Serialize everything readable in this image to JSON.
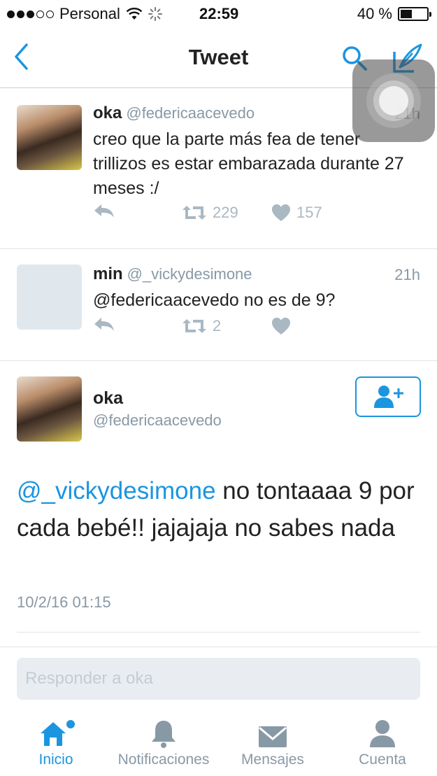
{
  "status_bar": {
    "carrier": "Personal",
    "time": "22:59",
    "battery": "40 %"
  },
  "nav": {
    "title": "Tweet"
  },
  "tweets": [
    {
      "name": "oka",
      "handle": "@federicaacevedo",
      "time": "21h",
      "text": "creo que la parte más fea de tener trillizos es estar embarazada durante 27 meses :/",
      "retweets": "229",
      "likes": "157"
    },
    {
      "name": "min",
      "handle": "@_vickydesimone",
      "time": "21h",
      "text": "@federicaacevedo no es de 9?",
      "retweets": "2",
      "likes": ""
    }
  ],
  "main_tweet": {
    "name": "oka",
    "handle": "@federicaacevedo",
    "mention": "@_vickydesimone",
    "text": " no tontaaaa 9 por cada bebé!! jajajaja no sabes nada",
    "date": "10/2/16 01:15"
  },
  "reply": {
    "placeholder": "Responder a oka"
  },
  "tabs": [
    {
      "label": "Inicio",
      "icon": "home-icon",
      "active": true
    },
    {
      "label": "Notificaciones",
      "icon": "bell-icon",
      "active": false
    },
    {
      "label": "Mensajes",
      "icon": "envelope-icon",
      "active": false
    },
    {
      "label": "Cuenta",
      "icon": "person-icon",
      "active": false
    }
  ],
  "colors": {
    "accent": "#1b95e0",
    "muted": "#8899a6",
    "action": "#aab8c2"
  }
}
